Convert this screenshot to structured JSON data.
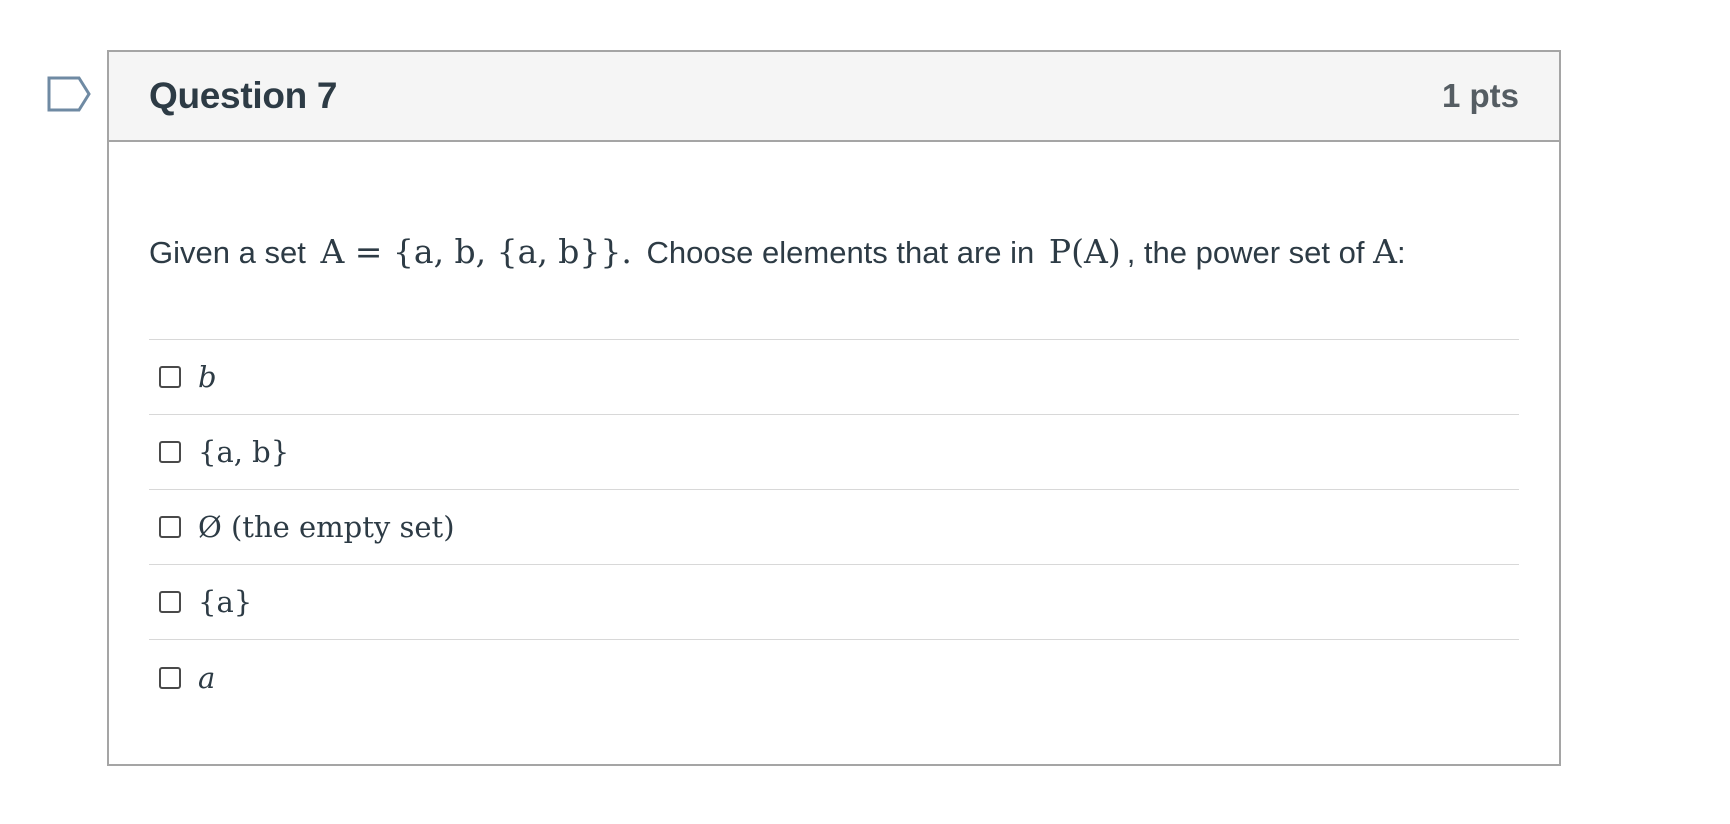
{
  "question": {
    "title": "Question 7",
    "points": "1 pts",
    "text_prefix": "Given a set",
    "set_expression": "A = {a, b, {a, b}}.",
    "text_middle": "Choose elements that are in",
    "power_set_expression": "P(A)",
    "text_suffix": ", the power set of",
    "set_name": "A",
    "text_end": ":"
  },
  "answers": [
    {
      "label": "b"
    },
    {
      "label": "{a, b}"
    },
    {
      "label": "Ø (the empty set)"
    },
    {
      "label": "{a}"
    },
    {
      "label": "a"
    }
  ],
  "icons": {
    "flag": "flag-outline-icon",
    "checkbox": "checkbox-unchecked-icon"
  },
  "colors": {
    "text": "#2d3b45",
    "header_bg": "#f5f5f5",
    "border": "#a5a5a5",
    "divider": "#d8d8d8",
    "flag_stroke": "#6f8aa3"
  }
}
